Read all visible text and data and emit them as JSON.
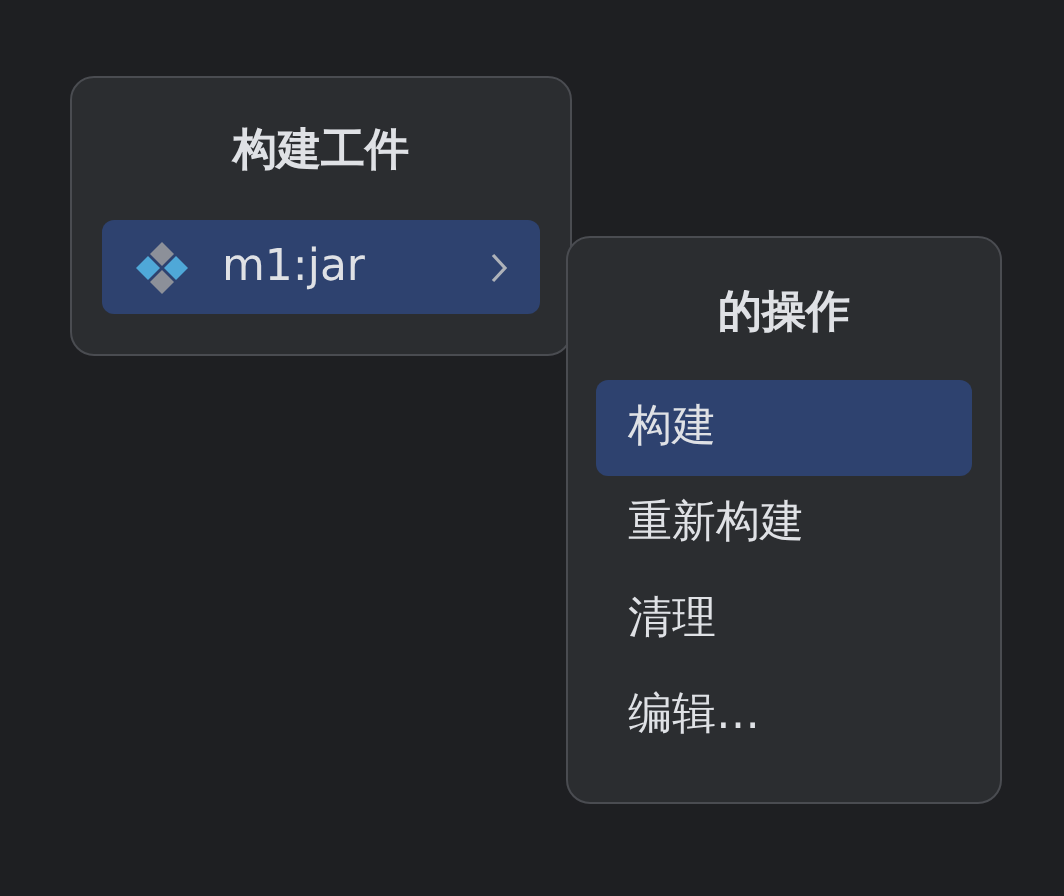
{
  "popups": [
    {
      "title": "构建工件",
      "items": [
        {
          "label": "m1:jar",
          "selected": true,
          "kind": "artifact",
          "submenu": true
        }
      ]
    },
    {
      "title": "的操作",
      "items": [
        {
          "label": "构建",
          "selected": true
        },
        {
          "label": "重新构建",
          "selected": false
        },
        {
          "label": "清理",
          "selected": false
        },
        {
          "label": "编辑…",
          "selected": false
        }
      ]
    }
  ]
}
